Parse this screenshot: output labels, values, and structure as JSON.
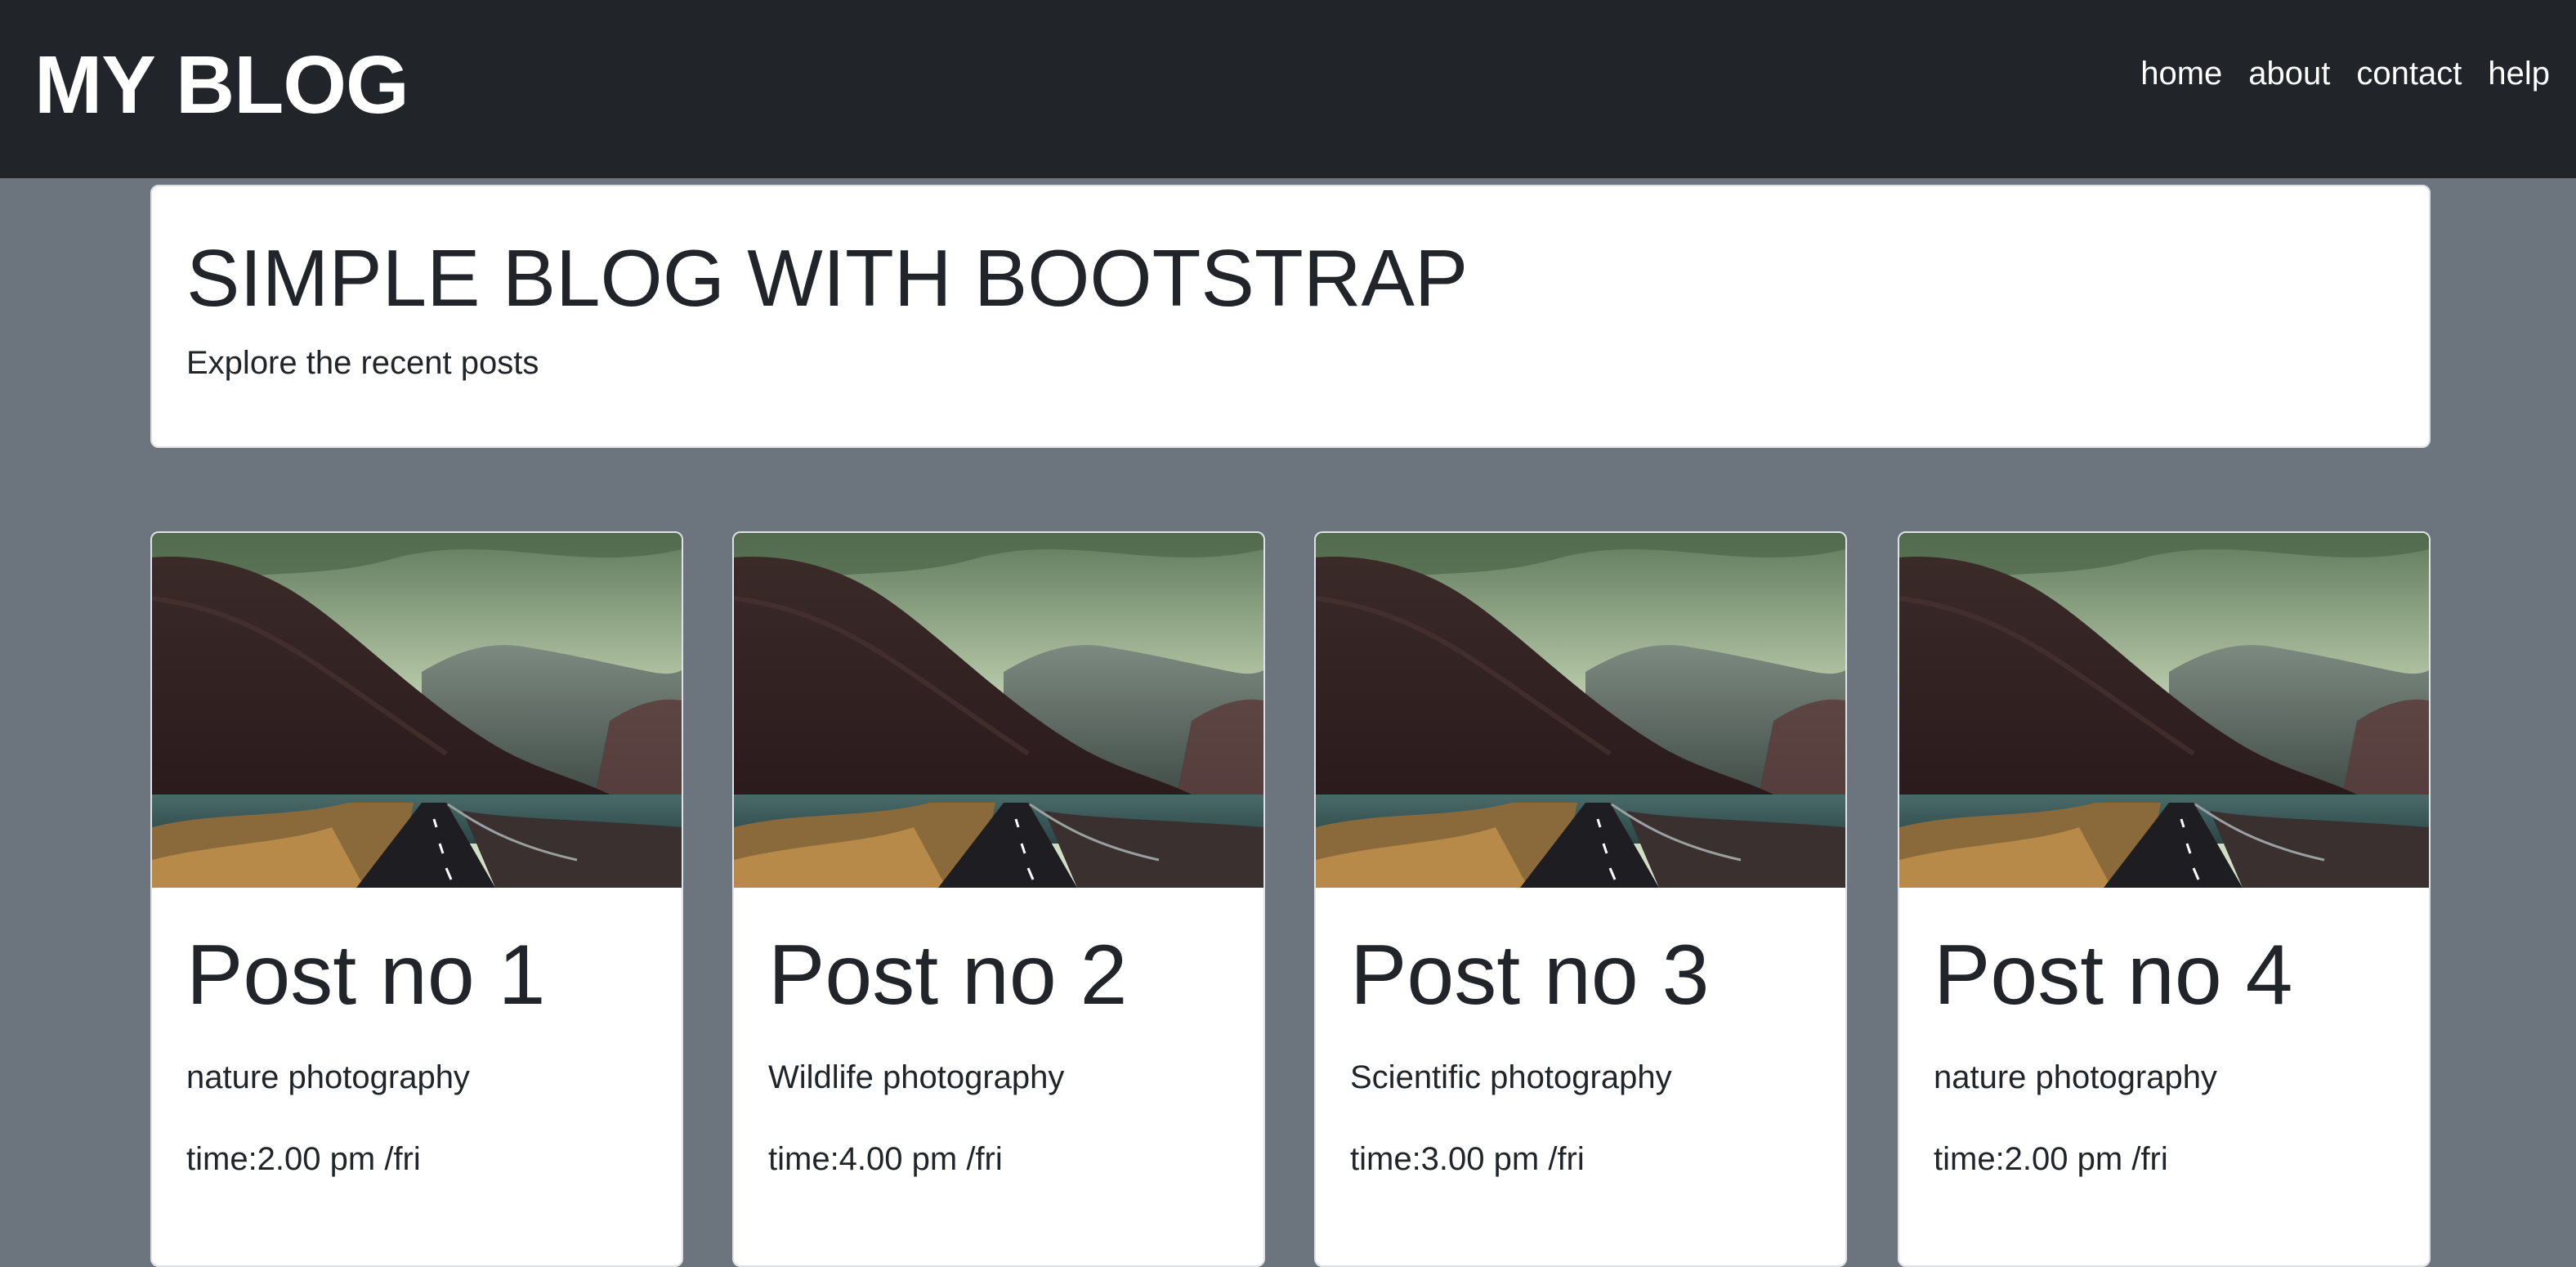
{
  "navbar": {
    "brand": "MY BLOG",
    "links": [
      "home",
      "about",
      "contact",
      "help"
    ]
  },
  "jumbotron": {
    "title": "SIMPLE BLOG WITH BOOTSTRAP",
    "lead": "Explore the recent posts"
  },
  "posts": [
    {
      "title": "Post no 1",
      "category": "nature photography",
      "time": "time:2.00 pm /fri",
      "image_icon": "mountain-road-photo"
    },
    {
      "title": "Post no 2",
      "category": "Wildlife photography",
      "time": "time:4.00 pm /fri",
      "image_icon": "mountain-road-photo"
    },
    {
      "title": "Post no 3",
      "category": "Scientific photography",
      "time": "time:3.00 pm /fri",
      "image_icon": "mountain-road-photo"
    },
    {
      "title": "Post no 4",
      "category": "nature photography",
      "time": "time:2.00 pm /fri",
      "image_icon": "mountain-road-photo"
    }
  ],
  "colors": {
    "navbar_bg": "#212529",
    "page_bg": "#6c757d",
    "card_bg": "#ffffff",
    "text": "#212529"
  }
}
